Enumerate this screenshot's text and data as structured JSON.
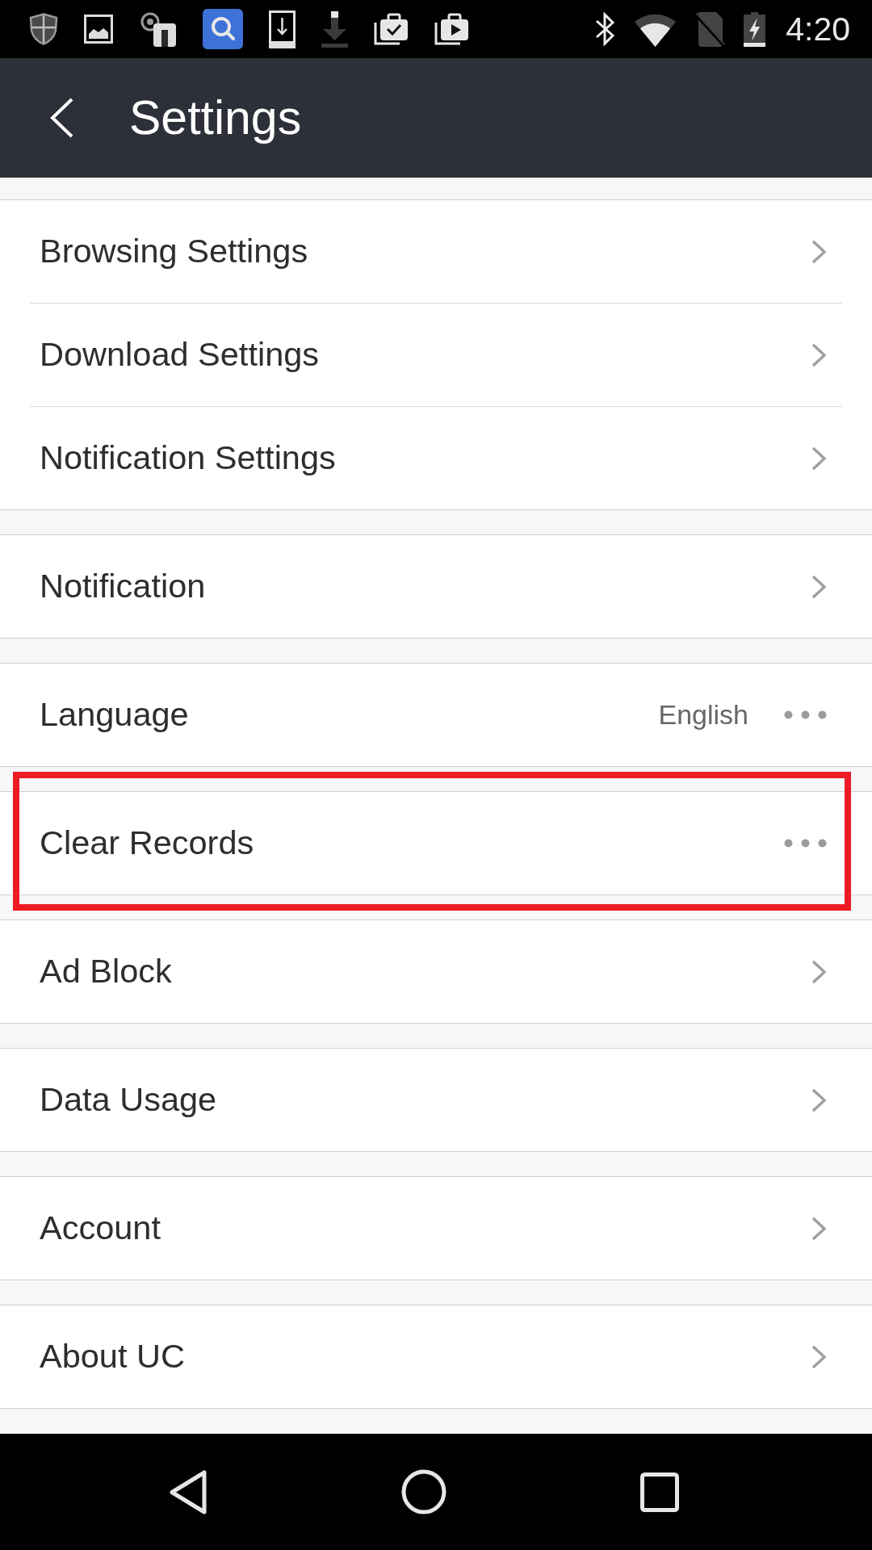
{
  "status_bar": {
    "time": "4:20"
  },
  "header": {
    "title": "Settings"
  },
  "groups": [
    {
      "items": [
        {
          "label": "Browsing Settings",
          "kind": "link",
          "highlighted": false
        },
        {
          "label": "Download Settings",
          "kind": "link",
          "highlighted": false
        },
        {
          "label": "Notification Settings",
          "kind": "link",
          "highlighted": false
        }
      ]
    },
    {
      "items": [
        {
          "label": "Notification",
          "kind": "link",
          "highlighted": false
        }
      ]
    },
    {
      "items": [
        {
          "label": "Language",
          "value": "English",
          "kind": "menu",
          "highlighted": false
        }
      ]
    },
    {
      "items": [
        {
          "label": "Clear Records",
          "kind": "menu",
          "highlighted": true
        }
      ]
    },
    {
      "items": [
        {
          "label": "Ad Block",
          "kind": "link",
          "highlighted": false
        }
      ]
    },
    {
      "items": [
        {
          "label": "Data Usage",
          "kind": "link",
          "highlighted": false
        }
      ]
    },
    {
      "items": [
        {
          "label": "Account",
          "kind": "link",
          "highlighted": false
        }
      ]
    },
    {
      "items": [
        {
          "label": "About UC",
          "kind": "link",
          "highlighted": false
        }
      ]
    }
  ]
}
